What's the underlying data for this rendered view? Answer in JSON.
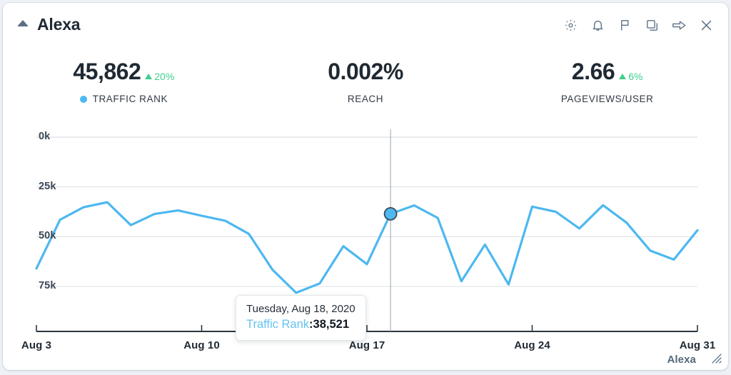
{
  "header": {
    "title": "Alexa",
    "collapse_icon": "triangle-up-icon",
    "icons": [
      {
        "name": "gear-icon",
        "label": "Settings"
      },
      {
        "name": "bell-icon",
        "label": "Alerts"
      },
      {
        "name": "flag-icon",
        "label": "Flag"
      },
      {
        "name": "duplicate-icon",
        "label": "Duplicate"
      },
      {
        "name": "arrow-right-icon",
        "label": "Move"
      },
      {
        "name": "close-icon",
        "label": "Close"
      }
    ]
  },
  "metrics": [
    {
      "value": "45,862",
      "delta": "20%",
      "delta_direction": "up",
      "label": "TRAFFIC RANK",
      "has_legend_dot": true
    },
    {
      "value": "0.002%",
      "delta": "",
      "delta_direction": "",
      "label": "REACH",
      "has_legend_dot": false
    },
    {
      "value": "2.66",
      "delta": "6%",
      "delta_direction": "up",
      "label": "PAGEVIEWS/USER",
      "has_legend_dot": false
    }
  ],
  "tooltip": {
    "date": "Tuesday, Aug 18, 2020",
    "series_label": "Traffic Rank",
    "separator": ":",
    "value": "38,521"
  },
  "footer": {
    "brand": "Alexa",
    "resize_handle": "resize-grip-icon"
  },
  "colors": {
    "line": "#4db8f0",
    "delta_up": "#3ecf8e",
    "text_dark": "#1f2933",
    "icon": "#5b7085",
    "grid": "#dcdfe3",
    "axis": "#2b3642"
  },
  "chart_data": {
    "type": "line",
    "title": "",
    "xlabel": "",
    "ylabel": "",
    "y_ticks": [
      "0k",
      "25k",
      "50k",
      "75k"
    ],
    "y_tick_values": [
      0,
      25000,
      50000,
      75000
    ],
    "y_axis_inverted": true,
    "ylim": [
      0,
      90000
    ],
    "grid": true,
    "legend_position": "top",
    "x_ticks": [
      "Aug 3",
      "Aug 10",
      "Aug 17",
      "Aug 24",
      "Aug 31"
    ],
    "x": [
      "Aug 3",
      "Aug 4",
      "Aug 5",
      "Aug 6",
      "Aug 7",
      "Aug 8",
      "Aug 9",
      "Aug 10",
      "Aug 11",
      "Aug 12",
      "Aug 13",
      "Aug 14",
      "Aug 15",
      "Aug 16",
      "Aug 17",
      "Aug 18",
      "Aug 19",
      "Aug 20",
      "Aug 21",
      "Aug 22",
      "Aug 23",
      "Aug 24",
      "Aug 25",
      "Aug 26",
      "Aug 27",
      "Aug 28",
      "Aug 29",
      "Aug 30",
      "Aug 31"
    ],
    "series": [
      {
        "name": "Traffic Rank",
        "color": "#4db8f0",
        "values": [
          66000,
          41500,
          35200,
          32700,
          44200,
          38600,
          36800,
          39500,
          42000,
          48600,
          66600,
          78200,
          73500,
          54800,
          63800,
          38521,
          34300,
          40600,
          72400,
          54000,
          74000,
          34900,
          37500,
          45900,
          34200,
          43000,
          57000,
          61500,
          46800
        ]
      }
    ],
    "highlight_point": {
      "x": "Aug 18",
      "value": 38521
    },
    "crosshair": true
  }
}
